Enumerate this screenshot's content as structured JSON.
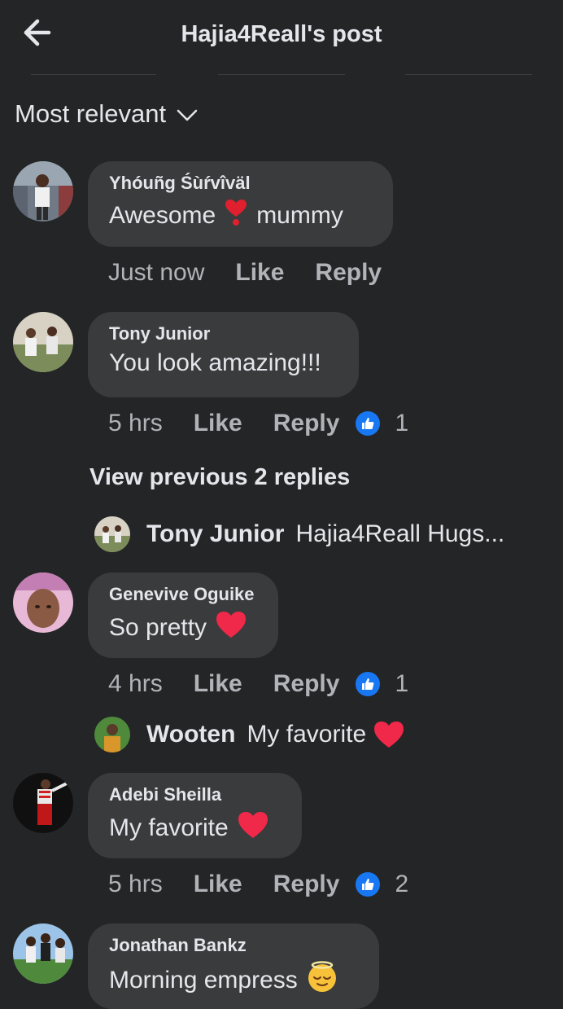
{
  "header": {
    "title": "Hajia4Reall's post"
  },
  "sort": {
    "label": "Most relevant"
  },
  "comments": [
    {
      "name": "Yhóuñg Śùŕvîväl",
      "text_before": "Awesome",
      "text_after": "mummy",
      "time": "Just now",
      "like": "Like",
      "reply": "Reply",
      "reactions": ""
    },
    {
      "name": "Tony Junior",
      "text_before": "You look amazing!!!",
      "text_after": "",
      "time": "5 hrs",
      "like": "Like",
      "reply": "Reply",
      "reactions": "1"
    },
    {
      "name": "Genevive Oguike",
      "text_before": "So pretty",
      "text_after": "",
      "time": "4 hrs",
      "like": "Like",
      "reply": "Reply",
      "reactions": "1"
    },
    {
      "name": "Adebi Sheilla",
      "text_before": "My favorite",
      "text_after": "",
      "time": "5 hrs",
      "like": "Like",
      "reply": "Reply",
      "reactions": "2"
    },
    {
      "name": "Jonathan Bankz",
      "text_before": "Morning empress",
      "text_after": "",
      "time": "",
      "like": "",
      "reply": "",
      "reactions": ""
    }
  ],
  "view_previous": "View previous 2 replies",
  "replies": [
    {
      "name": "Tony Junior",
      "text": "Hajia4Reall Hugs..."
    },
    {
      "name": "Wooten",
      "text": "My favorite"
    }
  ],
  "colors": {
    "background": "#242526",
    "bubble": "#3a3b3c",
    "text": "#e4e6eb",
    "meta": "#b0b3b8",
    "like_blue": "#1877f2",
    "heart": "#f02849"
  },
  "icons": {
    "back": "arrow-left-icon",
    "sort": "chevron-down-icon",
    "like": "thumbs-up-icon",
    "heart": "heart-emoji",
    "exclamation": "heavy-heart-exclamation-emoji",
    "relieved": "relieved-face-emoji"
  }
}
